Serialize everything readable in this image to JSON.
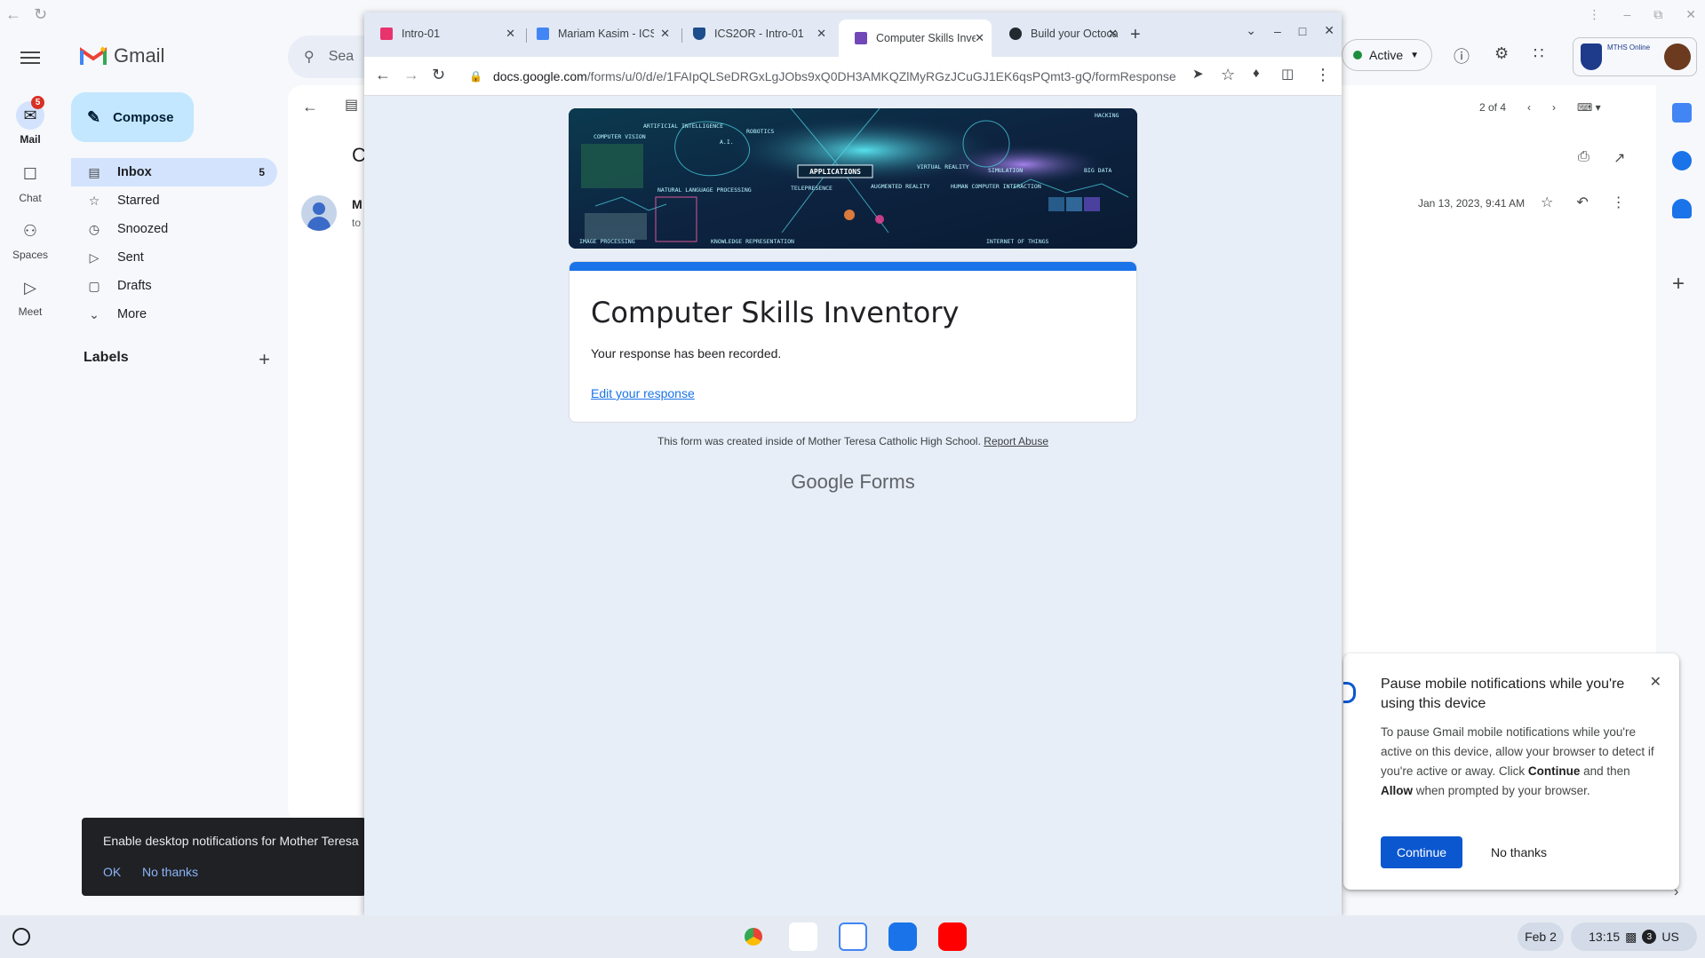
{
  "gmail": {
    "brand": "Gmail",
    "compose_label": "Compose",
    "search_placeholder": "Sea",
    "rail": [
      {
        "label": "Mail",
        "icon": "mail-icon",
        "badge": "5"
      },
      {
        "label": "Chat",
        "icon": "chat-icon"
      },
      {
        "label": "Spaces",
        "icon": "spaces-icon"
      },
      {
        "label": "Meet",
        "icon": "meet-icon"
      }
    ],
    "nav": [
      {
        "label": "Inbox",
        "icon": "inbox-icon",
        "count": "5"
      },
      {
        "label": "Starred",
        "icon": "star-icon"
      },
      {
        "label": "Snoozed",
        "icon": "clock-icon"
      },
      {
        "label": "Sent",
        "icon": "send-icon"
      },
      {
        "label": "Drafts",
        "icon": "draft-icon"
      },
      {
        "label": "More",
        "icon": "chevron-down-icon"
      }
    ],
    "labels_heading": "Labels",
    "status_label": "Active",
    "pager_text": "2 of 4",
    "message_date": "Jan 13, 2023, 9:41 AM",
    "sender_initial": "M",
    "to_fragment": "to",
    "subject_fragment": "C",
    "school_logo_text": "MTHS Online"
  },
  "notification_card": {
    "title": "Pause mobile notifications while you're using this device",
    "body_1": "To pause Gmail mobile notifications while you're active on this device, allow your browser to detect if you're active or away. Click ",
    "body_continue": "Continue",
    "body_2": " and then ",
    "body_allow": "Allow",
    "body_3": " when prompted by your browser.",
    "continue_label": "Continue",
    "no_thanks_label": "No thanks"
  },
  "desktop_toast": {
    "message": "Enable desktop notifications for Mother Teresa",
    "ok_label": "OK",
    "no_thanks_label": "No thanks"
  },
  "browser": {
    "tabs": [
      {
        "title": "Intro-01",
        "favicon_color": "#e8336d"
      },
      {
        "title": "Mariam Kasim - ICS",
        "favicon_color": "#4285f4"
      },
      {
        "title": "ICS2OR - Intro-01",
        "favicon_color": "#1e4d8c"
      },
      {
        "title": "Computer Skills Inve",
        "favicon_color": "#7248b9",
        "active": true
      },
      {
        "title": "Build your Octocat |",
        "favicon_color": "#24292f"
      }
    ],
    "url_host": "docs.google.com",
    "url_path": "/forms/u/0/d/e/1FAIpQLSeDRGxLgJObs9xQ0DH3AMKQZlMyRGzJCuGJ1EK6qsPQmt3-gQ/formResponse"
  },
  "form": {
    "title": "Computer Skills Inventory",
    "message": "Your response has been recorded.",
    "edit_link": "Edit your response",
    "footer_text": "This form was created inside of Mother Teresa Catholic High School.",
    "report_abuse": "Report Abuse",
    "brand_google": "Google",
    "brand_forms": "Forms",
    "banner_labels": [
      "ARTIFICIAL INTELLIGENCE",
      "ROBOTICS",
      "COMPUTER VISION",
      "APPLICATIONS",
      "VIRTUAL REALITY",
      "SIMULATION",
      "BIG DATA",
      "HACKING",
      "NATURAL LANGUAGE PROCESSING",
      "TELEPRESENCE",
      "AUGMENTED REALITY",
      "HUMAN COMPUTER INTERACTION",
      "IMAGE PROCESSING",
      "KNOWLEDGE REPRESENTATION",
      "INTERNET OF THINGS",
      "A.I."
    ]
  },
  "shelf": {
    "date": "Feb 2",
    "time": "13:15",
    "notif_count": "3",
    "locale": "US"
  }
}
